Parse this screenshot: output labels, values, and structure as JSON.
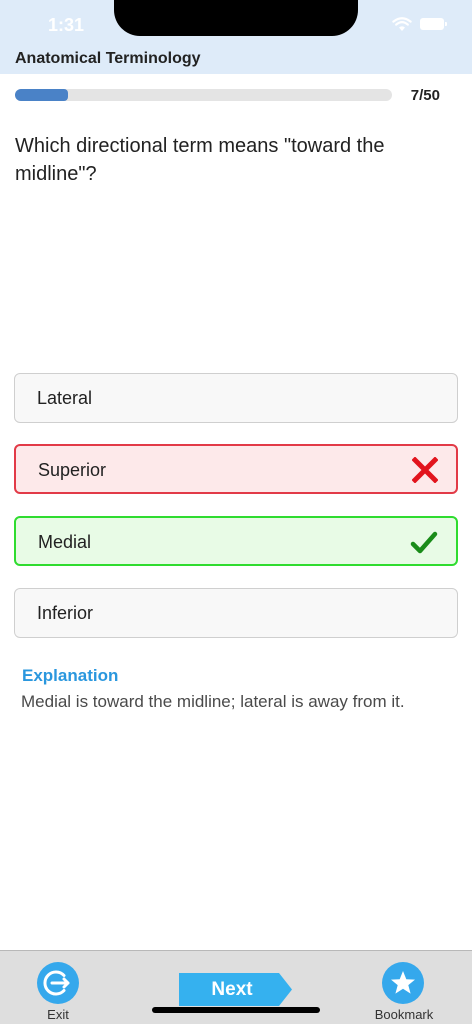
{
  "status_bar": {
    "time": "1:31"
  },
  "header": {
    "title": "Anatomical Terminology"
  },
  "progress": {
    "current": 7,
    "total": 50,
    "label": "7/50"
  },
  "question": {
    "text": "Which directional term means \"toward the midline\"?"
  },
  "options": [
    {
      "label": "Lateral",
      "state": "neutral"
    },
    {
      "label": "Superior",
      "state": "wrong"
    },
    {
      "label": "Medial",
      "state": "correct"
    },
    {
      "label": "Inferior",
      "state": "neutral"
    }
  ],
  "explanation": {
    "title": "Explanation",
    "text": "Medial is toward the midline; lateral is away from it."
  },
  "bottom_bar": {
    "exit_label": "Exit",
    "next_label": "Next",
    "bookmark_label": "Bookmark"
  },
  "colors": {
    "accent": "#35a8ec",
    "progress": "#4a82c7",
    "wrong": "#e23a47",
    "correct": "#1a9a1a",
    "header_bg": "#deebf9"
  },
  "icons": [
    "wifi-icon",
    "battery-icon",
    "cross-icon",
    "checkmark-icon",
    "exit-icon",
    "star-icon"
  ]
}
